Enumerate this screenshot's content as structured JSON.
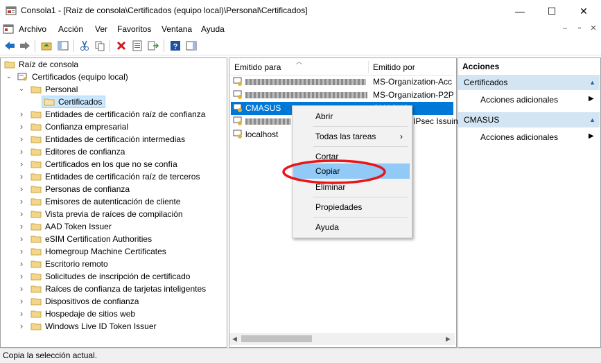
{
  "window": {
    "title": "Consola1 - [Raíz de consola\\Certificados (equipo local)\\Personal\\Certificados]",
    "minimize": "—",
    "maximize": "☐",
    "close": "✕"
  },
  "menubar": {
    "items": [
      "Archivo",
      "Acción",
      "Ver",
      "Favoritos",
      "Ventana",
      "Ayuda"
    ]
  },
  "tree": {
    "root": "Raíz de consola",
    "computer": "Certificados (equipo local)",
    "personal": "Personal",
    "selected": "Certificados",
    "stores": [
      "Entidades de certificación raíz de confianza",
      "Confianza empresarial",
      "Entidades de certificación intermedias",
      "Editores de confianza",
      "Certificados en los que no se confía",
      "Entidades de certificación raíz de terceros",
      "Personas de confianza",
      "Emisores de autenticación de cliente",
      "Vista previa de raíces de compilación",
      "AAD Token Issuer",
      "eSIM Certification Authorities",
      "Homegroup Machine Certificates",
      "Escritorio remoto",
      "Solicitudes de inscripción de certificado",
      "Raíces de confianza de tarjetas inteligentes",
      "Dispositivos de confianza",
      "Hospedaje de sitios web",
      "Windows Live ID Token Issuer"
    ]
  },
  "list": {
    "col_issued_to": "Emitido para",
    "col_issued_by": "Emitido por",
    "rows": [
      {
        "issued_to": "",
        "issued_by": "MS-Organization-Acc"
      },
      {
        "issued_to": "",
        "issued_by": "MS-Organization-P2P-"
      },
      {
        "issued_to": "CMASUS",
        "issued_by": "CMASUS"
      },
      {
        "issued_to": "",
        "issued_by": "IPsec Issuin"
      },
      {
        "issued_to": "localhost",
        "issued_by": ""
      }
    ]
  },
  "context_menu": {
    "open": "Abrir",
    "all_tasks": "Todas las tareas",
    "cut": "Cortar",
    "copy": "Copiar",
    "delete": "Eliminar",
    "properties": "Propiedades",
    "help": "Ayuda"
  },
  "actions": {
    "header": "Acciones",
    "section1": "Certificados",
    "section1_item": "Acciones adicionales",
    "section2": "CMASUS",
    "section2_item": "Acciones adicionales"
  },
  "status": "Copia la selección actual.",
  "colors": {
    "selection": "#0078d7",
    "menu_highlight": "#91c9f7",
    "annotation": "#e8151b",
    "action_section": "#d3e4f3"
  }
}
